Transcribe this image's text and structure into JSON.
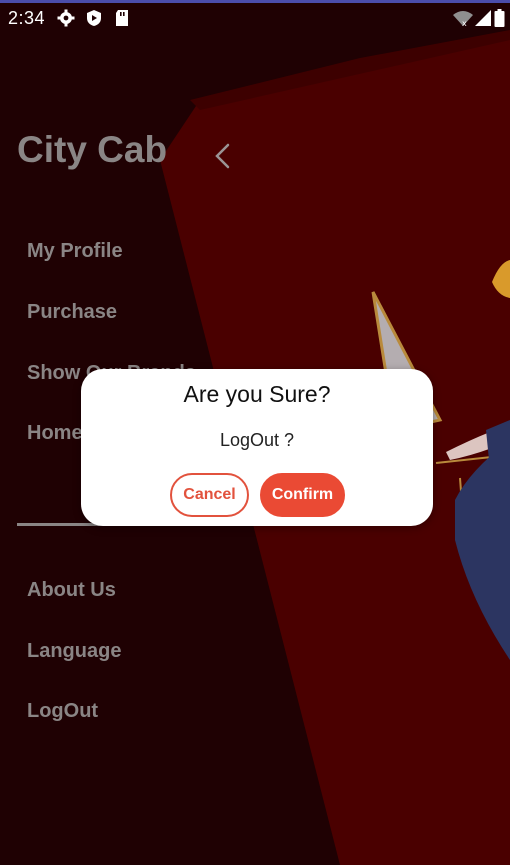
{
  "status_bar": {
    "time": "2:34",
    "left_icons": [
      "gear-icon",
      "shield-icon",
      "sd-card-icon"
    ],
    "right_icons": [
      "wifi-off-icon",
      "signal-icon",
      "battery-icon"
    ]
  },
  "drawer": {
    "title": "City Cab",
    "back_icon": "chevron-left-icon",
    "menu_items": [
      {
        "label": "My Profile"
      },
      {
        "label": "Purchase"
      },
      {
        "label": "Show Our Brands"
      },
      {
        "label": "Home"
      },
      {
        "label": "About Us"
      },
      {
        "label": "Language"
      },
      {
        "label": "LogOut"
      }
    ]
  },
  "dialog": {
    "title": "Are you Sure?",
    "message": "LogOut ?",
    "cancel_label": "Cancel",
    "confirm_label": "Confirm"
  },
  "colors": {
    "background": "#1f0103",
    "panel_red": "#4a0000",
    "accent_red": "#ea4a34",
    "menu_text": "#8a8585",
    "status_accent": "#4b4dab"
  }
}
